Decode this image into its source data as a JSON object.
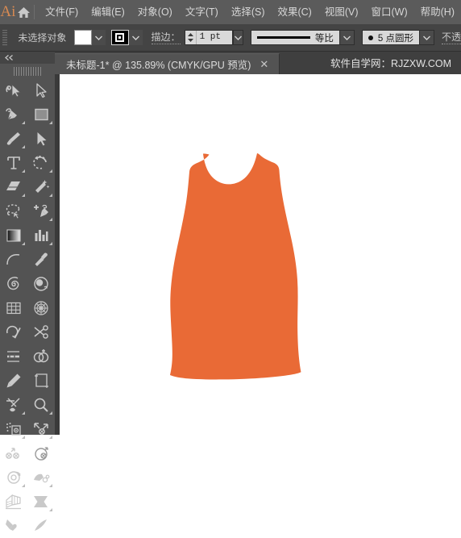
{
  "app": {
    "logo": "Ai",
    "home_icon": "home-icon"
  },
  "menubar": {
    "items": [
      {
        "label": "文件(F)",
        "name": "menu-file"
      },
      {
        "label": "编辑(E)",
        "name": "menu-edit"
      },
      {
        "label": "对象(O)",
        "name": "menu-object"
      },
      {
        "label": "文字(T)",
        "name": "menu-type"
      },
      {
        "label": "选择(S)",
        "name": "menu-select"
      },
      {
        "label": "效果(C)",
        "name": "menu-effect"
      },
      {
        "label": "视图(V)",
        "name": "menu-view"
      },
      {
        "label": "窗口(W)",
        "name": "menu-window"
      },
      {
        "label": "帮助(H)",
        "name": "menu-help"
      }
    ]
  },
  "controlbar": {
    "selection_status": "未选择对象",
    "fill_color": "#FFFFFF",
    "stroke_color": "#000000",
    "stroke_label": "描边：",
    "stroke_weight": "1 pt",
    "stroke_profile": "等比",
    "brush_definition": "5 点圆形",
    "opacity_label": "不透"
  },
  "tabbar": {
    "document_title": "未标题-1* @ 135.89% (CMYK/GPU 预览)",
    "close_glyph": "✕",
    "watermark": "软件自学网：RJZXW.COM"
  },
  "toolbar": {
    "collapse_glyph": "◄◄",
    "tools": [
      {
        "name": "tool-shaper",
        "icon": "shaper-icon",
        "has_flyout": false
      },
      {
        "name": "tool-selection",
        "icon": "selection-arrow-icon",
        "has_flyout": false
      },
      {
        "name": "tool-pen",
        "icon": "pen-icon",
        "has_flyout": true
      },
      {
        "name": "tool-rectangle",
        "icon": "rectangle-icon",
        "has_flyout": true
      },
      {
        "name": "tool-paintbrush",
        "icon": "paintbrush-icon",
        "has_flyout": true
      },
      {
        "name": "tool-direct-selection",
        "icon": "direct-selection-icon",
        "has_flyout": false
      },
      {
        "name": "tool-type",
        "icon": "type-icon",
        "has_flyout": true
      },
      {
        "name": "tool-rotate",
        "icon": "rotate-icon",
        "has_flyout": true
      },
      {
        "name": "tool-eraser",
        "icon": "eraser-icon",
        "has_flyout": true
      },
      {
        "name": "tool-magic-wand",
        "icon": "magic-wand-icon",
        "has_flyout": true
      },
      {
        "name": "tool-lasso",
        "icon": "lasso-icon",
        "has_flyout": false
      },
      {
        "name": "tool-add-anchor",
        "icon": "add-anchor-point-icon",
        "has_flyout": true
      },
      {
        "name": "tool-gradient",
        "icon": "gradient-icon",
        "has_flyout": true
      },
      {
        "name": "tool-column-graph",
        "icon": "column-graph-icon",
        "has_flyout": true
      },
      {
        "name": "tool-arc",
        "icon": "arc-icon",
        "has_flyout": false
      },
      {
        "name": "tool-eyedropper",
        "icon": "eyedropper-icon",
        "has_flyout": false
      },
      {
        "name": "tool-spiral",
        "icon": "spiral-icon",
        "has_flyout": false
      },
      {
        "name": "tool-blob-brush",
        "icon": "blob-brush-icon",
        "has_flyout": false
      },
      {
        "name": "tool-rectangular-grid",
        "icon": "rectangular-grid-icon",
        "has_flyout": false
      },
      {
        "name": "tool-polar-grid",
        "icon": "polar-grid-icon",
        "has_flyout": false
      },
      {
        "name": "tool-smooth",
        "icon": "smooth-icon",
        "has_flyout": false
      },
      {
        "name": "tool-scissors",
        "icon": "scissors-icon",
        "has_flyout": false
      },
      {
        "name": "tool-width",
        "icon": "width-icon",
        "has_flyout": false
      },
      {
        "name": "tool-shape-builder",
        "icon": "shape-builder-icon",
        "has_flyout": false
      },
      {
        "name": "tool-pencil",
        "icon": "pencil-icon",
        "has_flyout": false
      },
      {
        "name": "tool-artboard",
        "icon": "artboard-icon",
        "has_flyout": false
      },
      {
        "name": "tool-slice",
        "icon": "slice-icon",
        "has_flyout": true
      },
      {
        "name": "tool-zoom",
        "icon": "zoom-magnifier-icon",
        "has_flyout": true
      },
      {
        "name": "tool-perspective-grid",
        "icon": "perspective-grid-icon",
        "has_flyout": false
      },
      {
        "name": "tool-scale",
        "icon": "scale-icon",
        "has_flyout": false
      },
      {
        "name": "tool-free-transform",
        "icon": "free-transform-icon",
        "has_flyout": false
      },
      {
        "name": "tool-reshape",
        "icon": "reshape-icon",
        "has_flyout": false
      },
      {
        "name": "tool-blend",
        "icon": "blend-icon",
        "has_flyout": true
      },
      {
        "name": "tool-symbol-sprayer",
        "icon": "symbol-sprayer-icon",
        "has_flyout": true
      },
      {
        "name": "tool-perspective",
        "icon": "perspective-select-icon",
        "has_flyout": false
      },
      {
        "name": "tool-flag-warp",
        "icon": "flag-warp-icon",
        "has_flyout": true
      },
      {
        "name": "tool-hand",
        "icon": "hand-icon",
        "has_flyout": false
      },
      {
        "name": "tool-knife",
        "icon": "knife-icon",
        "has_flyout": false
      }
    ]
  },
  "artwork": {
    "name": "dress-shape",
    "fill_color": "#E96A36",
    "description": "sleeveless dress silhouette"
  }
}
